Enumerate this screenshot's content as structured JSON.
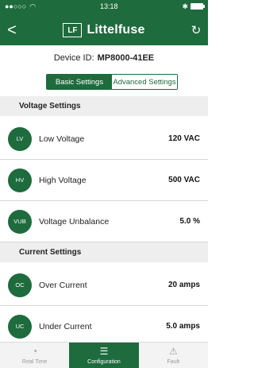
{
  "status": {
    "time": "13:18"
  },
  "header": {
    "brand": "Littelfuse",
    "logo_text": "LF"
  },
  "device": {
    "label": "Device ID:",
    "id": "MP8000-41EE"
  },
  "segments": {
    "basic": "Basic Settings",
    "advanced": "Advanced Settings",
    "selected": "Basic Settings"
  },
  "sections": [
    {
      "title": "Voltage Settings",
      "items": [
        {
          "abbr": "LV",
          "label": "Low Voltage",
          "value": "120 VAC"
        },
        {
          "abbr": "HV",
          "label": "High Voltage",
          "value": "500 VAC"
        },
        {
          "abbr": "VUB",
          "label": "Voltage Unbalance",
          "value": "5.0 %"
        }
      ]
    },
    {
      "title": "Current Settings",
      "items": [
        {
          "abbr": "OC",
          "label": "Over Current",
          "value": "20 amps"
        },
        {
          "abbr": "UC",
          "label": "Under Current",
          "value": "5.0 amps"
        }
      ]
    }
  ],
  "tabs": [
    {
      "label": "Real Time",
      "icon": "gauge-icon"
    },
    {
      "label": "Configuration",
      "icon": "sliders-icon"
    },
    {
      "label": "Fault",
      "icon": "fault-icon"
    }
  ],
  "active_tab": "Configuration",
  "colors": {
    "primary": "#1e6b3d",
    "section_bg": "#eeeeee",
    "tab_bg": "#f3f3f3"
  }
}
